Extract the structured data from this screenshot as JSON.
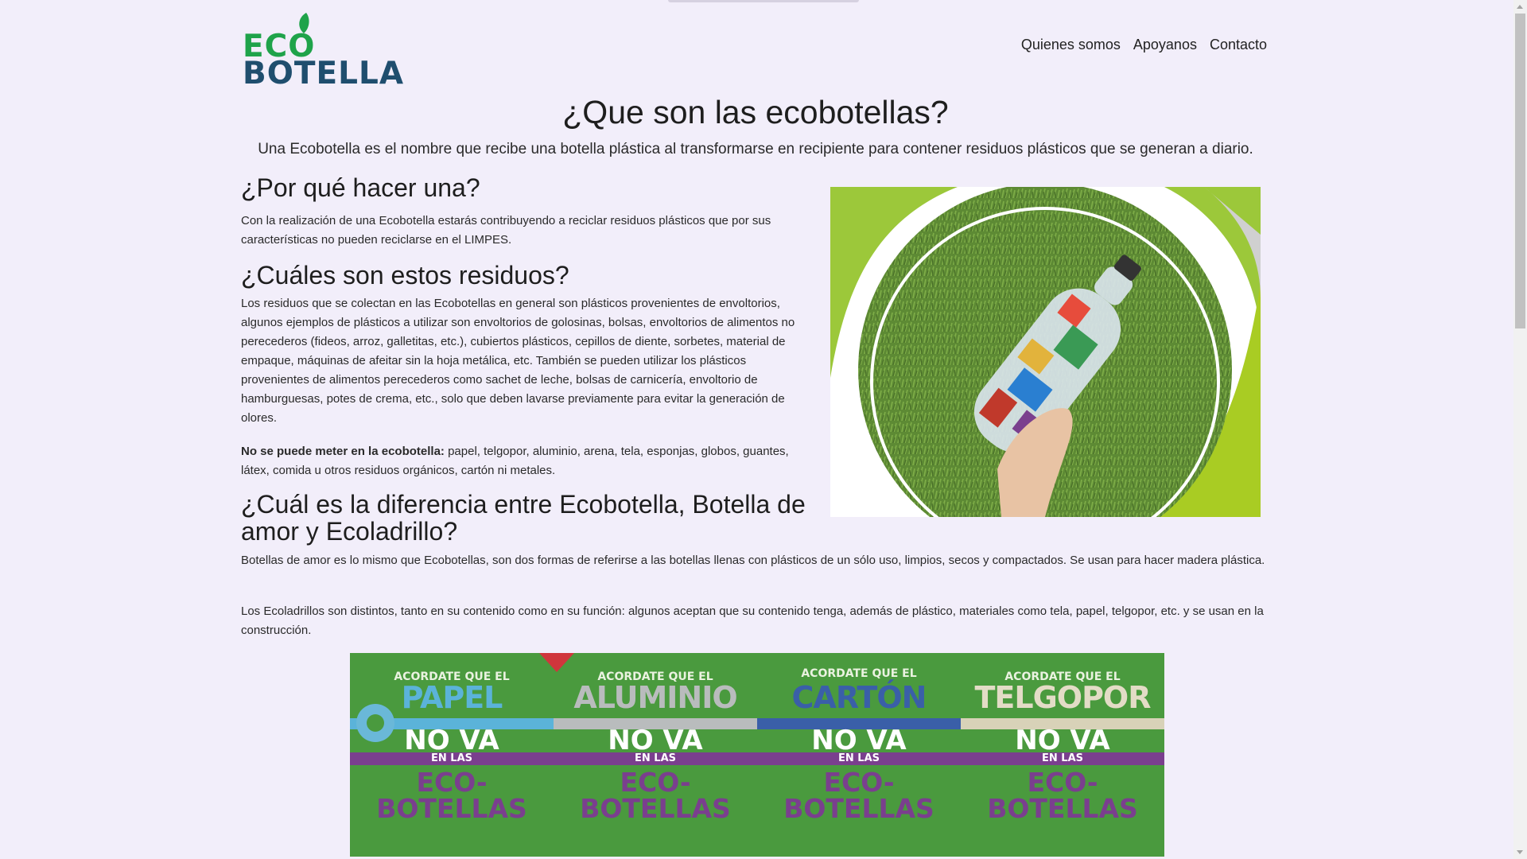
{
  "header": {
    "logo_top": "ECO",
    "logo_bottom": "BOTELLA",
    "nav": [
      {
        "label": "Quienes somos"
      },
      {
        "label": "Apoyanos"
      },
      {
        "label": "Contacto"
      }
    ]
  },
  "main": {
    "title": "¿Que son las ecobotellas?",
    "lead": "Una Ecobotella es el nombre que recibe una botella plástica al transformarse en recipiente para contener residuos plásticos que se generan a diario.",
    "porque": {
      "heading": "¿Por qué hacer una?",
      "text": "Con la realización de una Ecobotella estarás contribuyendo a reciclar residuos plásticos que por sus características no pueden reciclarse en el LIMPES."
    },
    "cuales": {
      "heading": "¿Cuáles son estos residuos?",
      "text": "Los residuos que se colectan en las Ecobotellas en general son plásticos provenientes de envoltorios, algunos ejemplos de plásticos a utilizar son envoltorios de golosinas, bolsas, envoltorios de alimentos no perecederos (fideos, arroz, galletitas, etc.), cubiertos plásticos, cepillos de diente, sorbetes, material de empaque, máquinas de afeitar sin la hoja metálica, etc. También se pueden utilizar los plásticos provenientes de alimentos perecederos como sachet de leche, bolsas de carnicería, envoltorio de hamburguesas, potes de crema, etc., solo que deben lavarse previamente para evitar la generación de olores.",
      "no_label": "No se puede meter en la ecobotella:",
      "no_text": " papel, telgopor, aluminio, arena, tela, esponjas, globos, guantes, látex, comida u otros residuos orgánicos, cartón ni metales."
    },
    "diferencia": {
      "heading": "¿Cuál es la diferencia entre Ecobotella, Botella de amor y Ecoladrillo?",
      "text_amor": "Botellas de amor es lo mismo que Ecobotellas, son dos formas de referirse a las botellas llenas con plásticos de un sólo uso, limpios, secos y compactados. Se usan para hacer madera plástica.",
      "text_ecoladrillo": "Los Ecoladrillos son distintos, tanto en su contenido como en su función: algunos aceptan que su contenido tenga, además de plástico, materiales como tela, papel, telgopor, etc. y se usan en la construcción."
    }
  },
  "banner": {
    "columns": [
      {
        "acordate": "ACORDATE QUE EL",
        "material": "PAPEL",
        "color": "#5bb3d9",
        "stripe": "#5bb3d9",
        "nova": "NO VA",
        "enlas": "EN LAS",
        "eco1": "ECO-",
        "eco2": "BOTELLAS"
      },
      {
        "acordate": "ACORDATE QUE EL",
        "material": "ALUMINIO",
        "color": "#b9bcbd",
        "stripe": "#b9bcbd",
        "nova": "NO VA",
        "enlas": "EN LAS",
        "eco1": "ECO-",
        "eco2": "BOTELLAS"
      },
      {
        "acordate": "ACORDATE QUE EL",
        "material": "CARTÓN",
        "color": "#3a5fa8",
        "stripe": "#3a5fa8",
        "nova": "NO VA",
        "enlas": "EN LAS",
        "eco1": "ECO-",
        "eco2": "BOTELLAS"
      },
      {
        "acordate": "ACORDATE QUE EL",
        "material": "TELGOPOR",
        "color": "#e3dcc6",
        "stripe": "#d8d2b8",
        "nova": "NO VA",
        "enlas": "EN LAS",
        "eco1": "ECO-",
        "eco2": "BOTELLAS"
      }
    ]
  },
  "colors": {
    "background": "#f2eefa",
    "logo_green": "#1fa34a",
    "logo_blue": "#1f4e6e",
    "banner_green": "#4a9a3e",
    "banner_purple": "#7a3f8e"
  }
}
